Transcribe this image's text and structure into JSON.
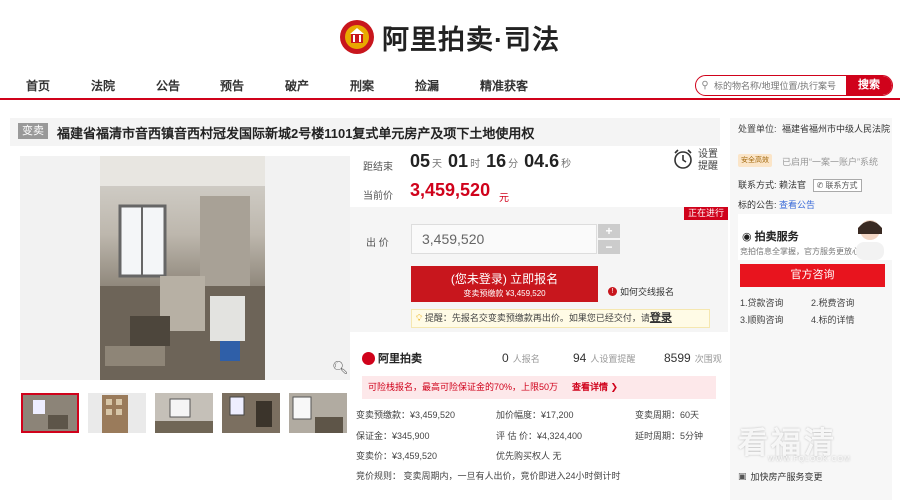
{
  "header": {
    "logo_text": "阿里拍卖·司法"
  },
  "nav": {
    "items": [
      "首页",
      "法院",
      "公告",
      "预告",
      "破产",
      "刑案",
      "捡漏",
      "精准获客"
    ]
  },
  "search": {
    "placeholder": "标的物名称/地理位置/执行案号",
    "button": "搜索"
  },
  "item": {
    "badge": "变卖",
    "title": "福建省福清市音西镇音西村冠发国际新城2号楼1101复式单元房产及项下土地使用权"
  },
  "countdown": {
    "label": "距结束",
    "days": "05",
    "days_unit": "天",
    "hours": "01",
    "hours_unit": "时",
    "minutes": "16",
    "minutes_unit": "分",
    "seconds": "04.6",
    "seconds_unit": "秒",
    "remind_label": "设置提醒"
  },
  "price": {
    "label": "当前价",
    "value": "3,459,520",
    "unit": "元"
  },
  "bid": {
    "status": "正在进行",
    "label": "出 价",
    "value": "3,459,520",
    "plus": "+",
    "minus": "−",
    "register_line1": "(您未登录) 立即报名",
    "register_line2": "变卖预缴款 ¥3,459,520",
    "how_to": "如何交线报名",
    "tip_text": "提醒：先报名交变卖预缴款再出价。如果您已经交付，请",
    "tip_login": "登录"
  },
  "stats": {
    "logo": "阿里拍卖",
    "signups": "0",
    "signups_label": "人报名",
    "reminders": "94",
    "reminders_label": "人设置提醒",
    "views": "8599",
    "views_label": "次围观"
  },
  "protect": {
    "text": "可险栈报名，最高可险保证金的70%，上限50万",
    "more": "查看详情 ❯"
  },
  "details": {
    "deposit_pre": "变卖预缴款：¥3,459,520",
    "increment": "加价幅度：¥17,200",
    "cycle": "变卖周期：60天",
    "guarantee": "保证金：¥345,900",
    "appraisal": "评 估 价：¥4,324,400",
    "delay": "延时周期：5分钟",
    "sale_price": "变卖价：¥3,459,520",
    "priority": "优先购买权人",
    "priority_value": "无",
    "rules": "竞价规则：  变卖周期内，一旦有人出价，竞价即进入24小时倒计时"
  },
  "side": {
    "unit_label": "处置单位:",
    "court": "福建省福州市中级人民法院",
    "safe_badge": "安全高效",
    "safe_text": "已启用“一案一账户”系统",
    "contact_label": "联系方式:",
    "contact_name": "赖法官",
    "contact_btn": "联系方式",
    "announce_label": "标的公告:",
    "announce_link": "查看公告",
    "service_title": "拍卖服务",
    "service_sub": "竞拍信息全掌握，官方服务更放心",
    "consult": "官方咨询",
    "services": [
      "1.贷款咨询",
      "2.税费咨询",
      "3.顺购咨询",
      "4.标的详情"
    ],
    "watermark": "看福清",
    "watermark_sub": "WWW.FQLOOK.COM",
    "footer": "加快房产服务变更"
  },
  "colors": {
    "brand": "#d0021b",
    "button": "#c8161d",
    "link": "#3a6bd8"
  }
}
